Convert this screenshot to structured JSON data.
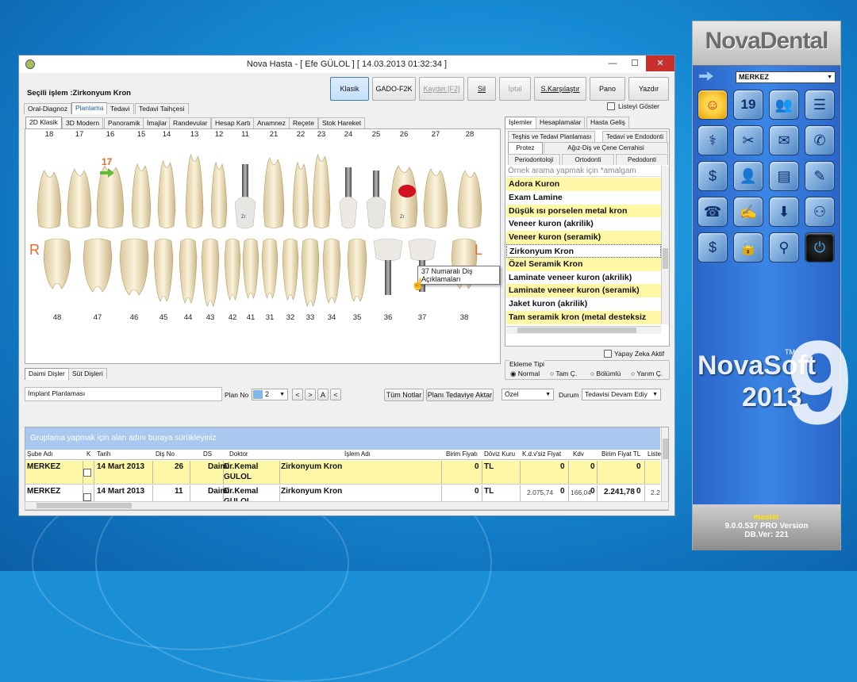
{
  "window": {
    "title": "Nova Hasta - [ Efe GÜLOL ]   [ 14.03.2013 01:32:34 ]",
    "selected_label": "Seçili işlem :Zirkonyum Kron",
    "toolbar": {
      "klasik": "Klasik",
      "gado": "GADO-F2K",
      "kaydet": "Kaydet [F2]",
      "sil": "Sil",
      "iptal": "İptal",
      "karsilastir": "S.Karşılaştır",
      "pano": "Pano",
      "yazdir": "Yazdır"
    },
    "main_tabs": [
      "Oral-Diagnoz",
      "Planlama",
      "Tedavi",
      "Tedavi Taihçesi"
    ],
    "listeyi_goster": "Listeyi Göster",
    "sub_tabs": [
      "2D Klasik",
      "3D Modern",
      "Panoramik",
      "İmajlar",
      "Randevular",
      "Hesap Kartı",
      "Anamnez",
      "Reçete",
      "Stok Hareket"
    ]
  },
  "chart": {
    "upper_numbers": [
      "18",
      "17",
      "16",
      "15",
      "14",
      "13",
      "12",
      "11",
      "21",
      "22",
      "23",
      "24",
      "25",
      "26",
      "27",
      "28"
    ],
    "lower_numbers": [
      "48",
      "47",
      "46",
      "45",
      "44",
      "43",
      "42",
      "41",
      "31",
      "32",
      "33",
      "34",
      "35",
      "36",
      "37",
      "38"
    ],
    "selected_tooth": "17",
    "right_label": "R",
    "left_label": "L",
    "tooltip": "37 Numaralı Diş Açıklamaları",
    "implant_marks": [
      "Zr",
      "Zr"
    ]
  },
  "right_panel": {
    "tabs": [
      "İşlemler",
      "Hesaplamalar",
      "Hasta Geliş"
    ],
    "cat_row1": [
      "Teşhis ve Tedavi Planlaması",
      "Tedavi ve Endodonti"
    ],
    "cat_row2": [
      "Protez",
      "Ağız-Diş ve Çene Cerrahisi"
    ],
    "cat_row3": [
      "Periodontoloji",
      "Ortodonti",
      "Pedodonti"
    ],
    "search_placeholder": "Örnek arama yapmak için *amalgam",
    "items": [
      "Adora Kuron",
      "Exam Lamine",
      "Düşük ısı porselen metal kron",
      "Veneer kuron (akrilik)",
      "Veneer kuron (seramik)",
      "Zirkonyum Kron",
      "Özel Seramik Kron",
      "Laminate veneer kuron (akrilik)",
      "Laminate veneer kuron (seramik)",
      "Jaket kuron (akrilik)",
      "Tam seramik kron (metal desteksiz"
    ],
    "yapay_zeka": "Yapay Zeka Aktif",
    "ekleme_tipi": "Ekleme Tipi",
    "radio": [
      "Normal",
      "Tam Ç.",
      "Bölümlü",
      "Yarım Ç."
    ]
  },
  "bottom": {
    "tabs": [
      "Daimi Dişler",
      "Süt Dişleri"
    ],
    "implant_label": "İmplant Planlaması",
    "plan_no_label": "Plan No",
    "plan_no": "2",
    "nav_buttons": [
      "<",
      ">",
      "A",
      "<"
    ],
    "tum_notlar": "Tüm Notlar",
    "plani_aktar": "Planı Tedaviye Aktar",
    "ozel": "Özel",
    "durum_label": "Durum",
    "durum_value": "Tedavisi Devam Ediy",
    "group_hint": "Gruplama yapmak için alan adını buraya sürükleyiniz",
    "columns": [
      "Şube Adı",
      "K",
      "Tarih",
      "Diş No",
      "DS",
      "Doktor",
      "İşlem Adı",
      "Birim Fiyatı",
      "Döviz Kuru",
      "K.d.v'siz Fiyat",
      "Kdv",
      "Birim Fiyat TL",
      "Liste"
    ],
    "rows": [
      {
        "sube": "MERKEZ",
        "tarih": "14 Mart 2013",
        "dis": "26",
        "ds": "Daimi",
        "doktor1": "Dr.Kemal",
        "doktor2": "GÜLOL",
        "islem": "Zirkonyum Kron",
        "birim": "0",
        "doviz": "TL",
        "kdvsiz": "0",
        "kdv": "0",
        "birimtl": "0"
      },
      {
        "sube": "MERKEZ",
        "tarih": "14 Mart 2013",
        "dis": "11",
        "ds": "Daimi",
        "doktor1": "Dr.Kemal",
        "doktor2": "GÜLOL",
        "islem": "Zirkonyum Kron",
        "birim": "0",
        "doviz": "TL",
        "kdvsiz": "0",
        "kdv": "0",
        "birimtl": "0"
      }
    ],
    "totals": {
      "kdvsiz": "2.075,74",
      "kdv": "166,04",
      "birimtl": "2.241,78",
      "liste": "2.2"
    }
  },
  "sidebar": {
    "brand": "NovaDental",
    "branch": "MERKEZ",
    "calendar_day": "19",
    "novasoft": "NovaSoft",
    "tm": "TM",
    "year": "2013",
    "big_nine": "9",
    "user": "master",
    "version": "9.0.0.537 PRO Version",
    "db_ver": "DB.Ver: 221"
  },
  "colors": {
    "highlight": "#fdf7a6",
    "accent": "#3c7fb1",
    "red": "#c7302b",
    "orange": "#e8682a"
  }
}
